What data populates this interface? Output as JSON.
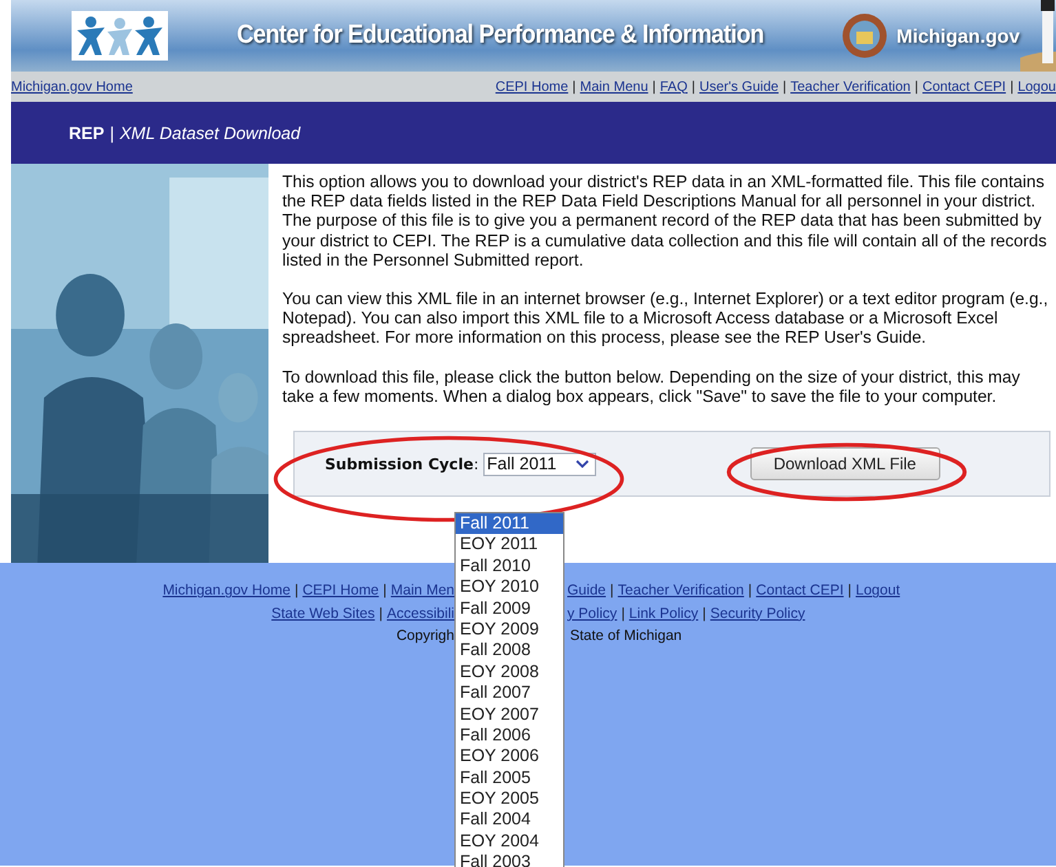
{
  "header": {
    "title": "Center for Educational Performance & Information",
    "brand": "Michigan.gov"
  },
  "nav": {
    "home_link": "Michigan.gov Home",
    "separator": "|",
    "links": [
      "CEPI Home",
      "Main Menu",
      "FAQ",
      "User's Guide",
      "Teacher Verification",
      "Contact CEPI",
      "Logou"
    ]
  },
  "page_title": {
    "section": "REP",
    "separator": "|",
    "name": "XML Dataset Download"
  },
  "paragraphs": [
    "This option allows you to download your district's REP data in an XML-formatted file. This file contains the REP data fields listed in the REP Data Field Descriptions Manual for all personnel in your district. The purpose of this file is to give you a permanent record of the REP data that has been submitted by your district to CEPI. The REP is a cumulative data collection and this file will contain all of the records listed in the Personnel Submitted report.",
    "You can view this XML file in an internet browser (e.g., Internet Explorer) or a text editor program (e.g., Notepad). You can also import this XML file to a Microsoft Access database or a Microsoft Excel spreadsheet. For more information on this process, please see the REP User's Guide.",
    "To download this file, please click the button below. Depending on the size of your district, this may take a few moments. When a dialog box appears, click \"Save\" to save the file to your computer."
  ],
  "form": {
    "label": "Submission Cycle",
    "label_suffix": ":",
    "select_value": "Fall 2011",
    "button": "Download XML File",
    "options": [
      {
        "label": "Fall 2011",
        "selected": true
      },
      {
        "label": "EOY 2011",
        "selected": false
      },
      {
        "label": "Fall 2010",
        "selected": false
      },
      {
        "label": "EOY 2010",
        "selected": false
      },
      {
        "label": "Fall 2009",
        "selected": false
      },
      {
        "label": "EOY 2009",
        "selected": false
      },
      {
        "label": "Fall 2008",
        "selected": false
      },
      {
        "label": "EOY 2008",
        "selected": false
      },
      {
        "label": "Fall 2007",
        "selected": false
      },
      {
        "label": "EOY 2007",
        "selected": false
      },
      {
        "label": "Fall 2006",
        "selected": false
      },
      {
        "label": "EOY 2006",
        "selected": false
      },
      {
        "label": "Fall 2005",
        "selected": false
      },
      {
        "label": "EOY 2005",
        "selected": false
      },
      {
        "label": "Fall 2004",
        "selected": false
      },
      {
        "label": "EOY 2004",
        "selected": false
      },
      {
        "label": "Fall 2003",
        "selected": false
      }
    ]
  },
  "footer": {
    "separator": "|",
    "lines": [
      {
        "left": [
          {
            "text": "Michigan.gov Home",
            "kind": "link"
          },
          {
            "text": "CEPI Home",
            "kind": "link"
          },
          {
            "text": "Main Men",
            "kind": "link"
          }
        ],
        "right": [
          {
            "text": "Guide",
            "kind": "link"
          },
          {
            "text": "Teacher Verification",
            "kind": "link"
          },
          {
            "text": "Contact CEPI",
            "kind": "link"
          },
          {
            "text": "Logout",
            "kind": "link"
          }
        ]
      },
      {
        "left": [
          {
            "text": "State Web Sites",
            "kind": "link"
          },
          {
            "text": "Accessibili",
            "kind": "link"
          }
        ],
        "right": [
          {
            "text": "y Policy",
            "kind": "link"
          },
          {
            "text": "Link Policy",
            "kind": "link"
          },
          {
            "text": "Security Policy",
            "kind": "link"
          }
        ]
      },
      {
        "left": [
          {
            "text": "Copyrigh",
            "kind": "text"
          }
        ],
        "right": [
          {
            "text": "State of Michigan",
            "kind": "text"
          }
        ]
      }
    ]
  }
}
